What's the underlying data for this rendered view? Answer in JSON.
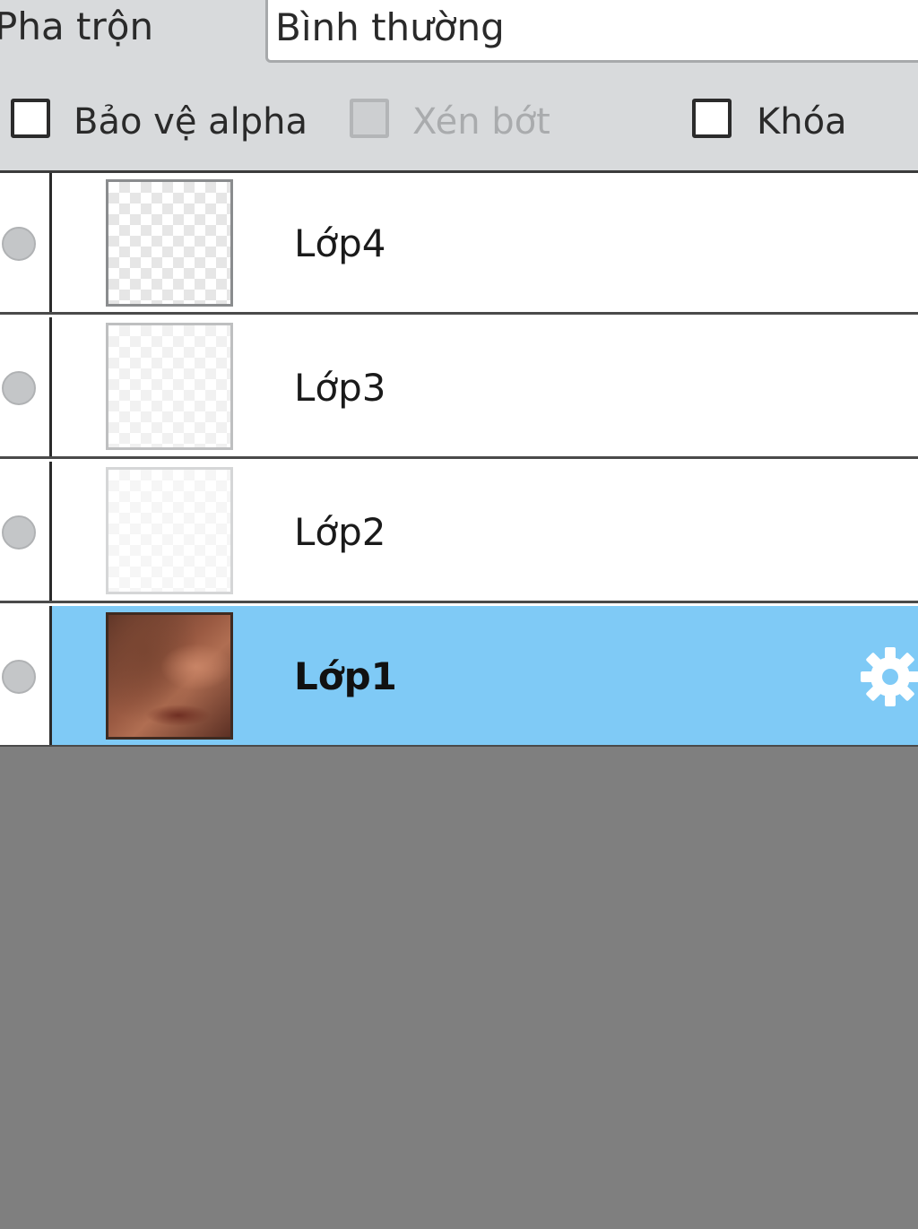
{
  "blend": {
    "label": "Pha trộn",
    "mode_value": "Bình thường"
  },
  "options": [
    {
      "label": "Bảo vệ alpha",
      "checked": false,
      "enabled": true
    },
    {
      "label": "Xén bớt",
      "checked": false,
      "enabled": false
    },
    {
      "label": "Khóa",
      "checked": false,
      "enabled": true
    }
  ],
  "layers": [
    {
      "name": "Lớp4",
      "selected": false,
      "thumbnail": "transparent"
    },
    {
      "name": "Lớp3",
      "selected": false,
      "thumbnail": "transparent"
    },
    {
      "name": "Lớp2",
      "selected": false,
      "thumbnail": "mostly-transparent"
    },
    {
      "name": "Lớp1",
      "selected": true,
      "thumbnail": "face-photo"
    }
  ],
  "icons": {
    "visibility": "visibility-dot-icon",
    "layer_settings": "gear-icon"
  },
  "colors": {
    "selected_row": "#7fcaf6",
    "empty_area": "#7f7f7f",
    "toolbar": "#d8dadc"
  }
}
